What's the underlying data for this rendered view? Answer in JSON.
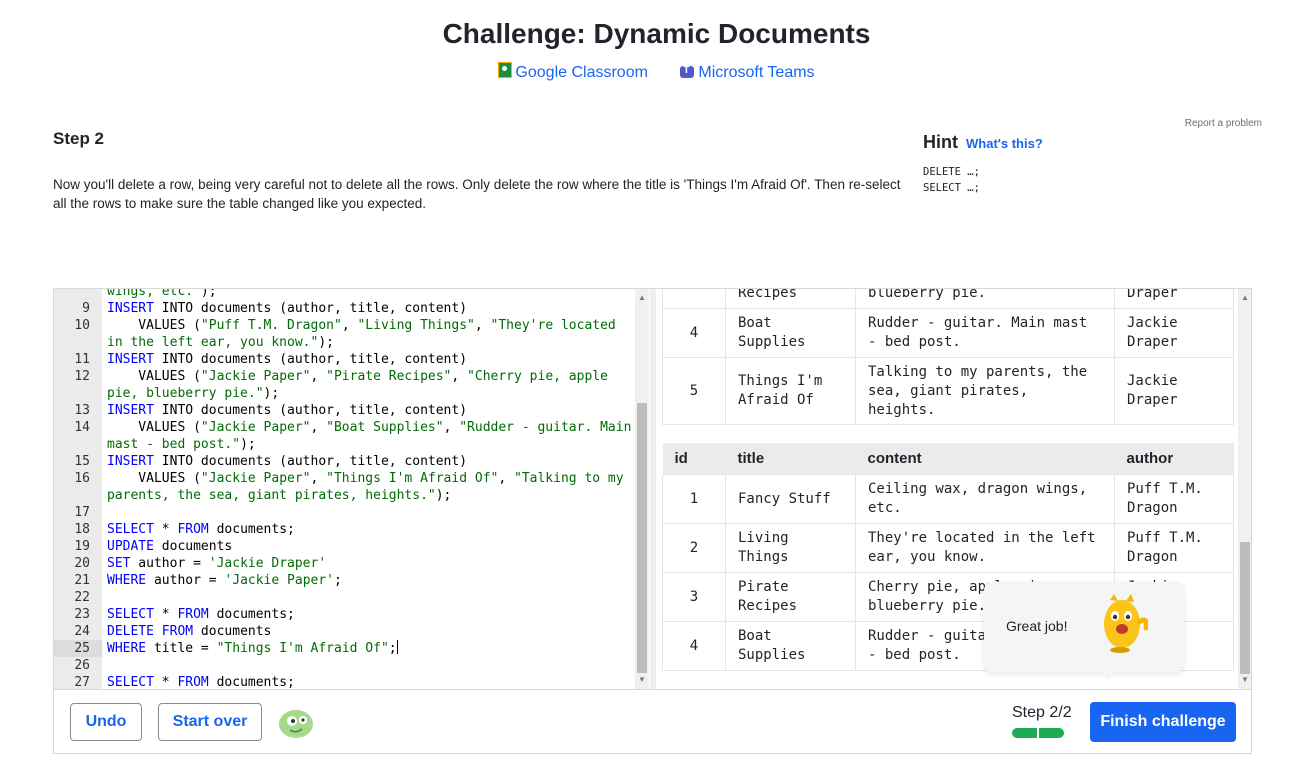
{
  "page": {
    "title": "Challenge: Dynamic Documents"
  },
  "share": {
    "google_classroom": "Google Classroom",
    "microsoft_teams": "Microsoft Teams"
  },
  "report": "Report a problem",
  "step": {
    "title": "Step 2",
    "description": "Now you'll delete a row, being very careful not to delete all the rows. Only delete the row where the title is 'Things I'm Afraid Of'. Then re-select all the rows to make sure the table changed like you expected."
  },
  "hint": {
    "title": "Hint",
    "whats_this": "What's this?",
    "lines": [
      "DELETE …;",
      "SELECT …;"
    ]
  },
  "editor": {
    "lines": [
      {
        "n": "",
        "html": "<span class=\"str\">wings, etc.\"</span>);"
      },
      {
        "n": "9",
        "html": "<span class=\"kw\">INSERT</span> INTO documents (author, title, content)"
      },
      {
        "n": "10",
        "html": "    VALUES (<span class=\"str\">\"Puff T.M. Dragon\"</span>, <span class=\"str\">\"Living Things\"</span>, <span class=\"str\">\"They're located</span>"
      },
      {
        "n": "",
        "html": "<span class=\"str\">in the left ear, you know.\"</span>);"
      },
      {
        "n": "11",
        "html": "<span class=\"kw\">INSERT</span> INTO documents (author, title, content)"
      },
      {
        "n": "12",
        "html": "    VALUES (<span class=\"str\">\"Jackie Paper\"</span>, <span class=\"str\">\"Pirate Recipes\"</span>, <span class=\"str\">\"Cherry pie, apple</span>"
      },
      {
        "n": "",
        "html": "<span class=\"str\">pie, blueberry pie.\"</span>);"
      },
      {
        "n": "13",
        "html": "<span class=\"kw\">INSERT</span> INTO documents (author, title, content)"
      },
      {
        "n": "14",
        "html": "    VALUES (<span class=\"str\">\"Jackie Paper\"</span>, <span class=\"str\">\"Boat Supplies\"</span>, <span class=\"str\">\"Rudder - guitar. Main</span>"
      },
      {
        "n": "",
        "html": "<span class=\"str\">mast - bed post.\"</span>);"
      },
      {
        "n": "15",
        "html": "<span class=\"kw\">INSERT</span> INTO documents (author, title, content)"
      },
      {
        "n": "16",
        "html": "    VALUES (<span class=\"str\">\"Jackie Paper\"</span>, <span class=\"str\">\"Things I'm Afraid Of\"</span>, <span class=\"str\">\"Talking to my</span>"
      },
      {
        "n": "",
        "html": "<span class=\"str\">parents, the sea, giant pirates, heights.\"</span>);"
      },
      {
        "n": "17",
        "html": ""
      },
      {
        "n": "18",
        "html": "<span class=\"kw\">SELECT</span> * <span class=\"kw\">FROM</span> documents;"
      },
      {
        "n": "19",
        "html": "<span class=\"kw\">UPDATE</span> documents"
      },
      {
        "n": "20",
        "html": "<span class=\"kw\">SET</span> author = <span class=\"str\">'Jackie Draper'</span>"
      },
      {
        "n": "21",
        "html": "<span class=\"kw\">WHERE</span> author = <span class=\"str\">'Jackie Paper'</span>;"
      },
      {
        "n": "22",
        "html": ""
      },
      {
        "n": "23",
        "html": "<span class=\"kw\">SELECT</span> * <span class=\"kw\">FROM</span> documents;"
      },
      {
        "n": "24",
        "html": "<span class=\"kw\">DELETE</span> <span class=\"kw\">FROM</span> documents"
      },
      {
        "n": "25",
        "html": "<span class=\"kw\">WHERE</span> title = <span class=\"str\">\"Things I'm Afraid Of\"</span>;<span class=\"cursor\"></span>",
        "active": true
      },
      {
        "n": "26",
        "html": ""
      },
      {
        "n": "27",
        "html": "<span class=\"kw\">SELECT</span> * <span class=\"kw\">FROM</span> documents;"
      }
    ]
  },
  "results": {
    "table1": {
      "rows": [
        {
          "id": "",
          "title": "Recipes",
          "content": "blueberry pie.",
          "author": "Draper"
        },
        {
          "id": "4",
          "title": "Boat Supplies",
          "content": "Rudder - guitar. Main mast - bed post.",
          "author": "Jackie Draper"
        },
        {
          "id": "5",
          "title": "Things I'm Afraid Of",
          "content": "Talking to my parents, the sea, giant pirates, heights.",
          "author": "Jackie Draper"
        }
      ]
    },
    "table2": {
      "headers": [
        "id",
        "title",
        "content",
        "author"
      ],
      "rows": [
        {
          "id": "1",
          "title": "Fancy Stuff",
          "content": "Ceiling wax, dragon wings, etc.",
          "author": "Puff T.M. Dragon"
        },
        {
          "id": "2",
          "title": "Living Things",
          "content": "They're located in the left ear, you know.",
          "author": "Puff T.M. Dragon"
        },
        {
          "id": "3",
          "title": "Pirate Recipes",
          "content": "Cherry pie, apple pie, blueberry pie.",
          "author": "Jackie Draper"
        },
        {
          "id": "4",
          "title": "Boat Supplies",
          "content": "Rudder - guitar. Main mast - bed post.",
          "author": "Jackie Draper"
        }
      ]
    }
  },
  "toast": {
    "message": "Great job!"
  },
  "footer": {
    "undo": "Undo",
    "start_over": "Start over",
    "step_counter": "Step 2/2",
    "progress_completed": 2,
    "progress_total": 2,
    "finish": "Finish challenge"
  }
}
